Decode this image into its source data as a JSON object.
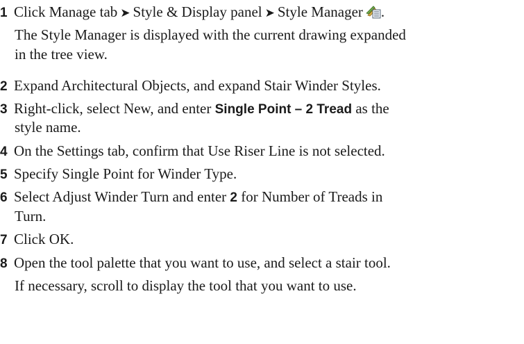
{
  "steps": [
    {
      "num": "1",
      "parts": [
        "Click Manage tab",
        "Style & Display panel",
        "Style Manager",
        "."
      ],
      "arrow": "➤",
      "icon": "style-manager-icon",
      "note_line1": "The Style Manager is displayed with the current drawing expanded",
      "note_line2": "in the tree view."
    },
    {
      "num": "2",
      "text": "Expand Architectural Objects, and expand Stair Winder Styles."
    },
    {
      "num": "3",
      "pre": "Right-click, select New, and enter ",
      "bold": "Single Point – 2 Tread",
      "post": " as the",
      "line2": "style name."
    },
    {
      "num": "4",
      "text": "On the Settings tab, confirm that Use Riser Line is not selected."
    },
    {
      "num": "5",
      "text": "Specify Single Point for Winder Type."
    },
    {
      "num": "6",
      "pre": "Select Adjust Winder Turn and enter ",
      "bold": "2",
      "post": " for Number of Treads in",
      "line2": "Turn."
    },
    {
      "num": "7",
      "text": "Click OK."
    },
    {
      "num": "8",
      "text": "Open the tool palette that you want to use, and select a stair tool.",
      "note": "If necessary, scroll to display the tool that you want to use."
    }
  ]
}
